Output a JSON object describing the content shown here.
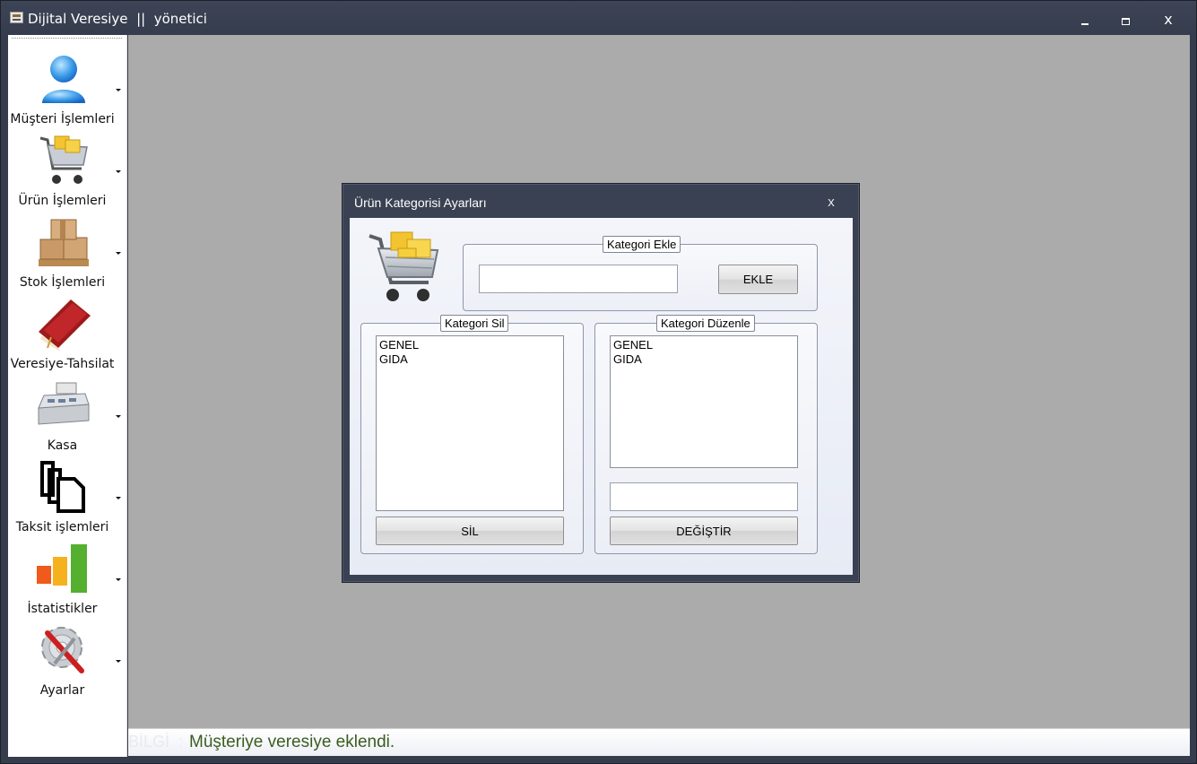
{
  "window": {
    "title": "Dijital Veresiye  ||  yönetici",
    "minimize_glyph": "",
    "maximize_glyph": "",
    "close_glyph": "x"
  },
  "sidebar": {
    "items": [
      {
        "label": "Müşteri İşlemleri",
        "icon": "user-icon"
      },
      {
        "label": "Ürün İşlemleri",
        "icon": "shopping-cart-icon"
      },
      {
        "label": "Stok İşlemleri",
        "icon": "boxes-icon"
      },
      {
        "label": "Veresiye-Tahsilat",
        "icon": "ledger-book-icon"
      },
      {
        "label": "Kasa",
        "icon": "cash-register-icon"
      },
      {
        "label": "Taksit işlemleri",
        "icon": "documents-icon"
      },
      {
        "label": "İstatistikler",
        "icon": "bar-chart-icon"
      },
      {
        "label": "Ayarlar",
        "icon": "settings-gear-icon"
      }
    ]
  },
  "dialog": {
    "title": "Ürün Kategorisi Ayarları",
    "close_glyph": "x",
    "add_group": {
      "label": "Kategori Ekle",
      "input_value": "",
      "button_label": "EKLE"
    },
    "delete_group": {
      "label": "Kategori Sil",
      "items": [
        "GENEL",
        "GIDA"
      ],
      "button_label": "SİL"
    },
    "edit_group": {
      "label": "Kategori Düzenle",
      "items": [
        "GENEL",
        "GIDA"
      ],
      "input_value": "",
      "button_label": "DEĞİŞTİR"
    }
  },
  "status": {
    "prefix": "BİLGİ  :",
    "message": "Müşteriye veresiye eklendi."
  },
  "colors": {
    "titlebar": "#353c4c",
    "mdi_background": "#ababab",
    "status_text": "#3b5d20",
    "dialog_body": "#eef1f8"
  }
}
